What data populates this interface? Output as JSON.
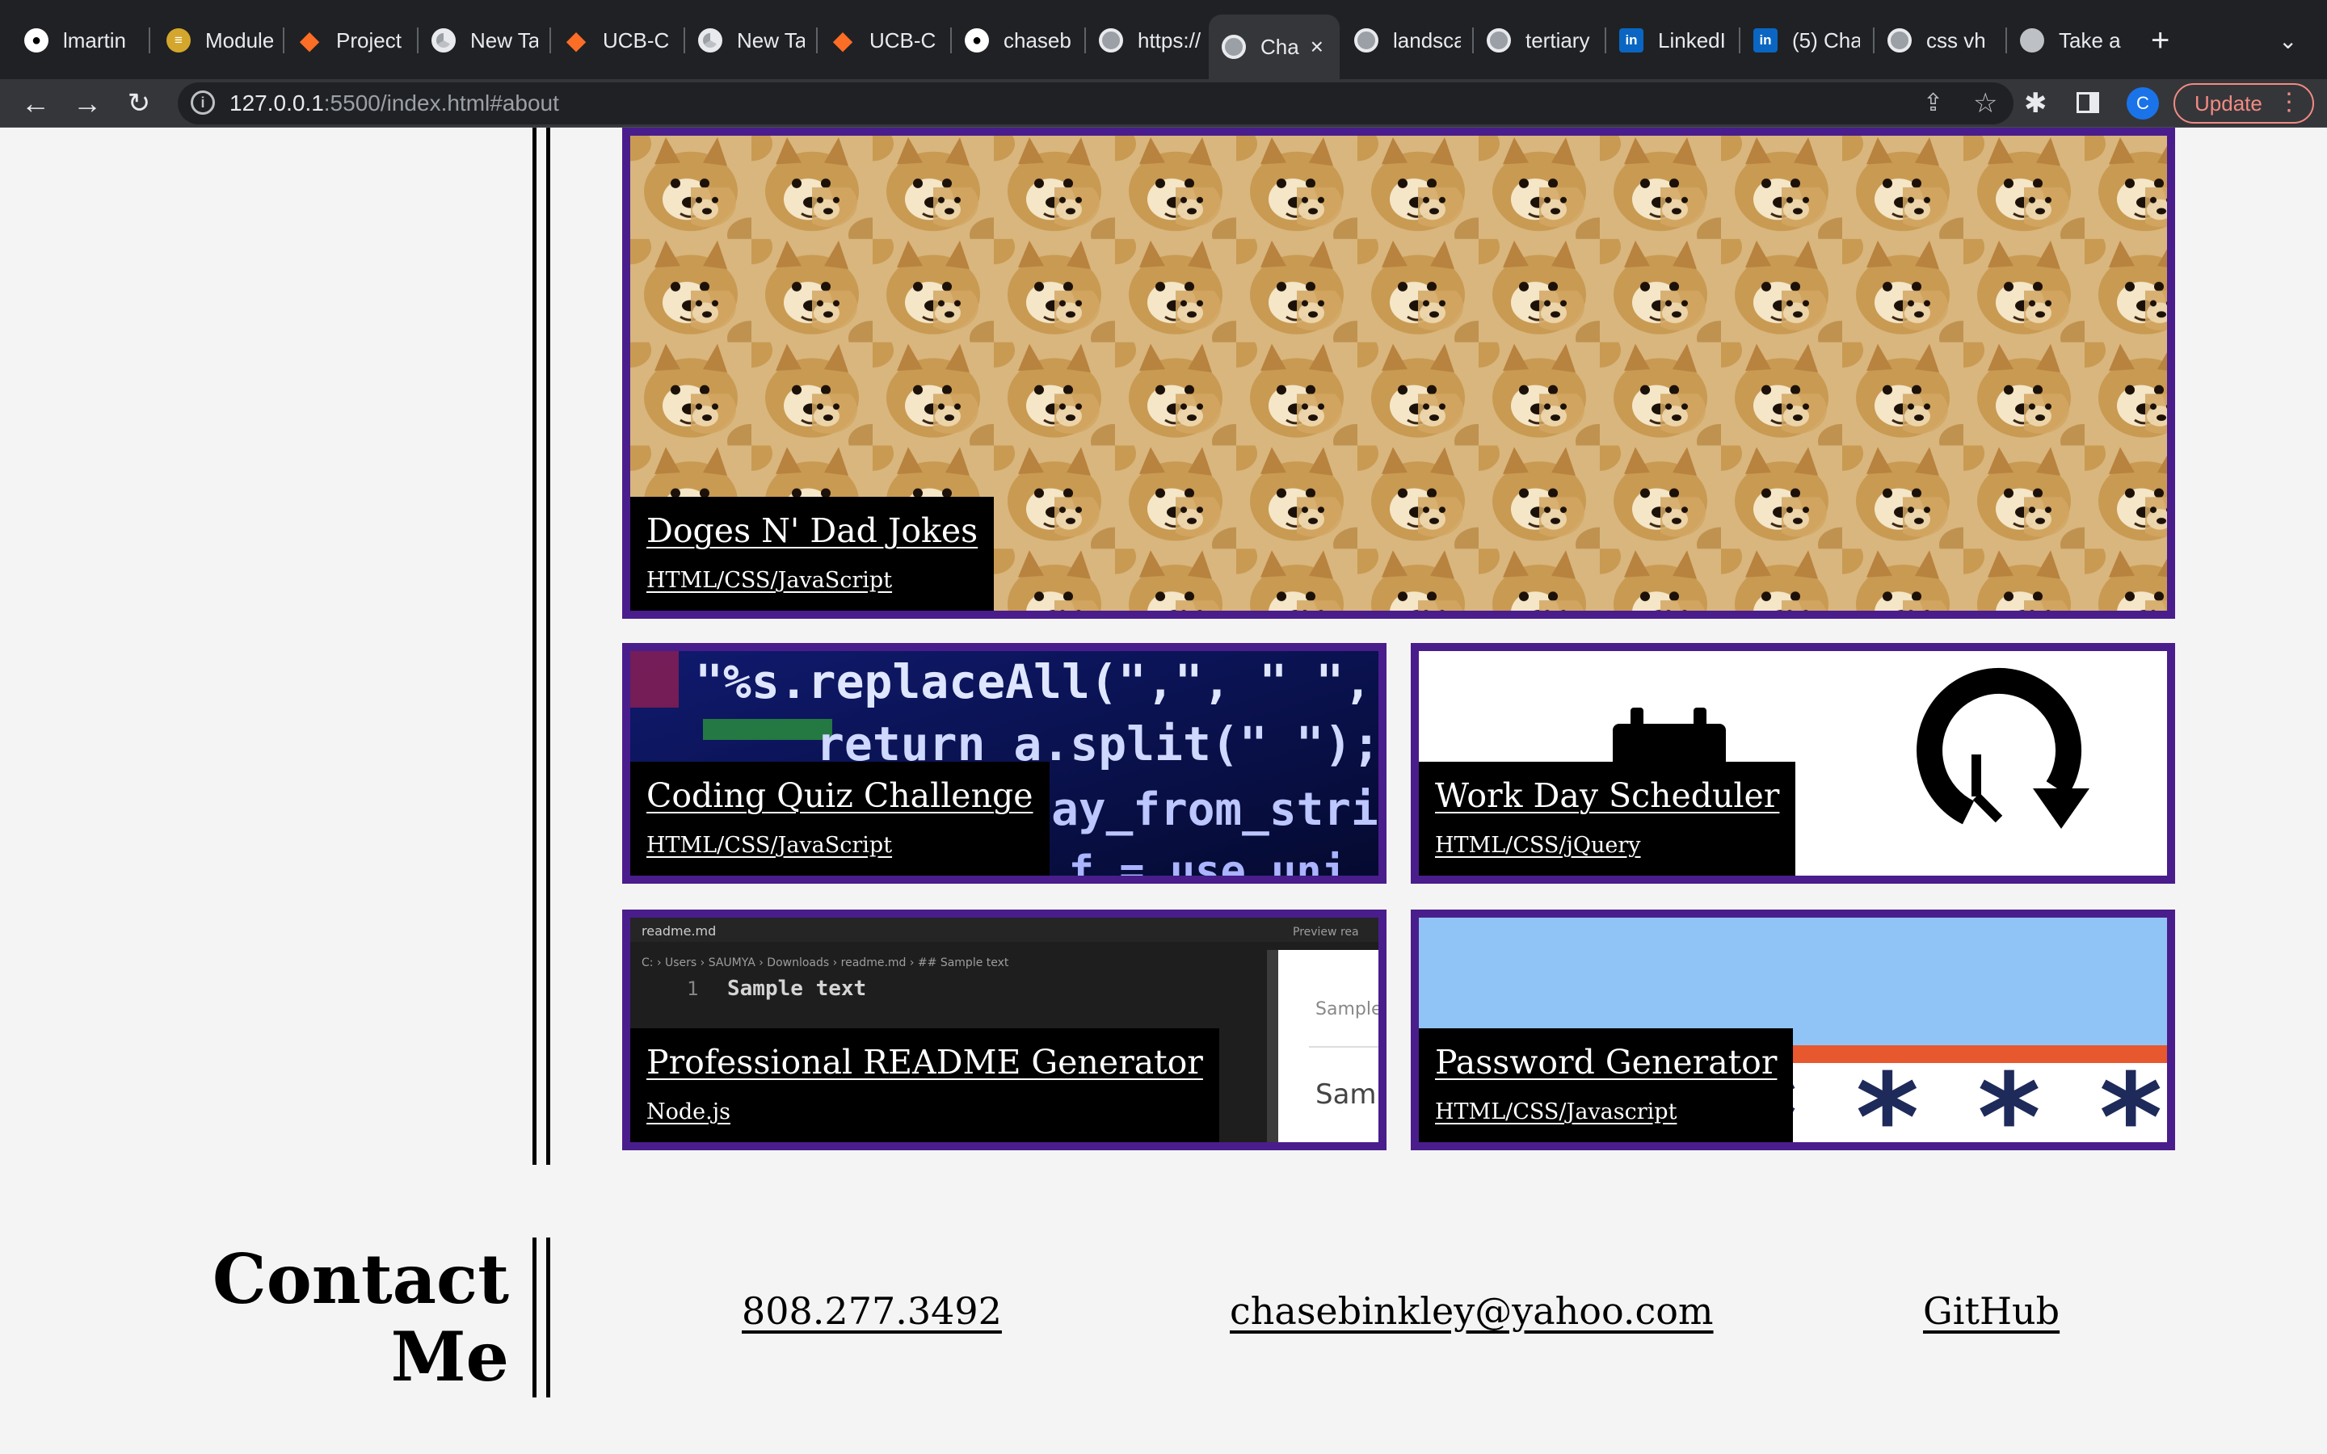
{
  "browser": {
    "tabs": [
      {
        "label": "lmartin",
        "icon": "github-icon"
      },
      {
        "label": "Module",
        "icon": "module-icon"
      },
      {
        "label": "Project",
        "icon": "gitlab-icon"
      },
      {
        "label": "New Ta",
        "icon": "chrome-icon"
      },
      {
        "label": "UCB-C",
        "icon": "gitlab-icon"
      },
      {
        "label": "New Ta",
        "icon": "chrome-icon"
      },
      {
        "label": "UCB-C",
        "icon": "gitlab-icon"
      },
      {
        "label": "chaseb",
        "icon": "github-icon"
      },
      {
        "label": "https://",
        "icon": "globe-icon"
      },
      {
        "label": "Cha",
        "icon": "globe-icon",
        "active": true
      },
      {
        "label": "landsca",
        "icon": "globe-icon"
      },
      {
        "label": "tertiary",
        "icon": "globe-icon"
      },
      {
        "label": "LinkedI",
        "icon": "linkedin-icon"
      },
      {
        "label": "(5) Cha",
        "icon": "linkedin-icon"
      },
      {
        "label": "css vh",
        "icon": "globe-icon"
      },
      {
        "label": "Take a",
        "icon": "apple-icon"
      }
    ],
    "address": {
      "host": "127.0.0.1",
      "path": ":5500/index.html#about"
    },
    "update_label": "Update",
    "profile_initial": "C"
  },
  "projects": [
    {
      "title": "Doges N' Dad Jokes",
      "tech": "HTML/CSS/JavaScript",
      "image": "doge-collage"
    },
    {
      "title": "Coding Quiz Challenge",
      "tech": "HTML/CSS/JavaScript",
      "image": "code-screenshot",
      "code_lines": [
        "\"%s.replaceAll(\",\", \" \", a)",
        "return a.split(\" \"); } $(",
        "array_from_string(",
        "( f = use uni"
      ]
    },
    {
      "title": "Work Day Scheduler",
      "tech": "HTML/CSS/jQuery",
      "image": "scheduler-icons"
    },
    {
      "title": "Professional README Generator",
      "tech": "Node.js",
      "image": "readme-screenshot",
      "editor": {
        "filename": "readme.md",
        "breadcrumb": "C: › Users › SAUMYA › Downloads › readme.md › ## Sample text",
        "line_number": "1",
        "line_text": "Sample text",
        "preview_tab": "Preview rea",
        "preview_text_1": "Sample",
        "preview_text_2": "Samp"
      }
    },
    {
      "title": "Password Generator",
      "tech": "HTML/CSS/Javascript",
      "image": "password-stars",
      "mask": "* * * * *"
    }
  ],
  "contact": {
    "heading_line1": "Contact",
    "heading_line2": "Me",
    "phone": "808.277.3492",
    "email": "chasebinkley@yahoo.com",
    "github": "GitHub"
  },
  "colors": {
    "card_border": "#4a1d8c",
    "caption_bg": "#000000",
    "page_bg": "#f4f4f4"
  }
}
